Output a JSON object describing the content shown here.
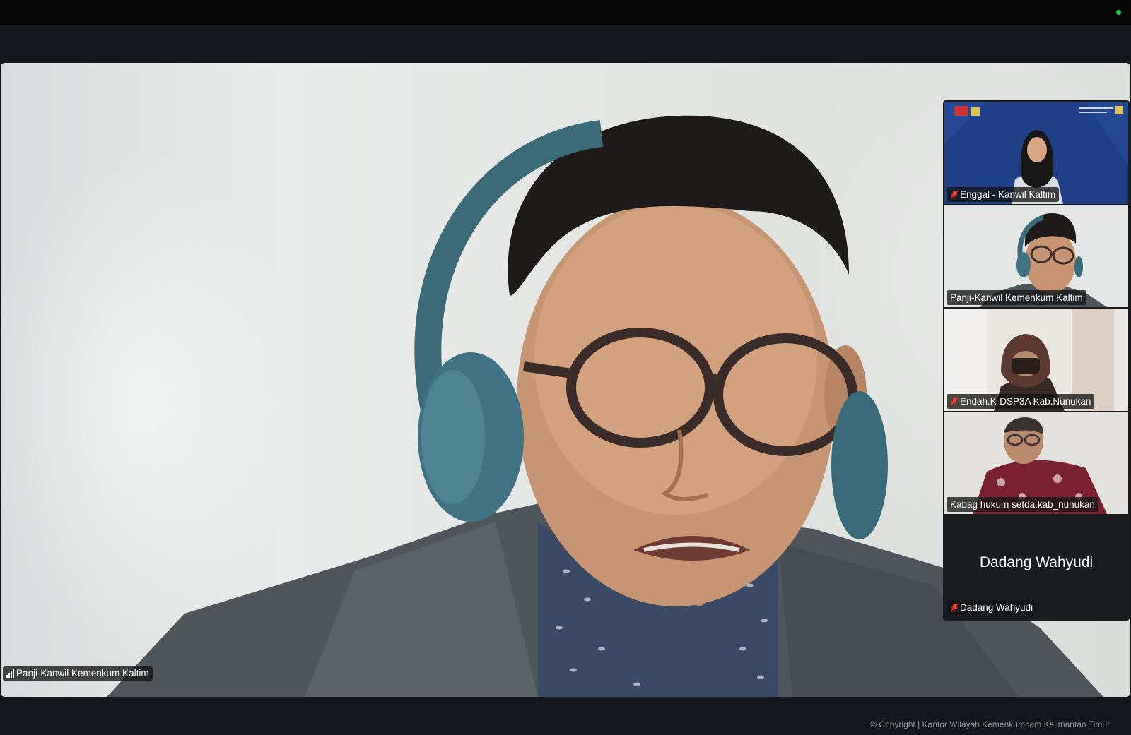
{
  "window": {
    "status_indicator_color": "#1fd14a"
  },
  "main_video": {
    "participant_name": "Panji-Kanwil Kemenkum Kaltim",
    "icon": "signal-strength-icon"
  },
  "gallery": {
    "active_speaker_color": "#23c552",
    "tiles": [
      {
        "name": "Enggal - Kanwil Kaltim",
        "muted": true,
        "icon": "mic-off-icon"
      },
      {
        "name": "Panji-Kanwil Kemenkum Kaltim",
        "muted": false,
        "active": true
      },
      {
        "name": "Endah.K-DSP3A Kab.Nunukan",
        "muted": true,
        "icon": "mic-off-icon"
      },
      {
        "name": "Kabag hukum setda.kab_nunukan",
        "muted": false
      },
      {
        "name": "Dadang Wahyudi",
        "display_name": "Dadang Wahyudi",
        "muted": true,
        "video_off": true,
        "icon": "mic-off-icon"
      }
    ]
  },
  "footer": {
    "copyright": "© Copyright | Kantor Wilayah Kemenkumham Kalimantan Timur"
  }
}
